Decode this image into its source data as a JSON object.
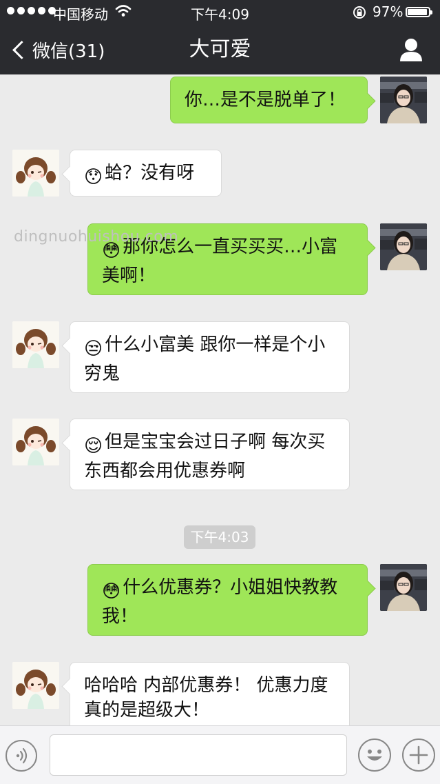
{
  "status_bar": {
    "carrier": "中国移动",
    "time": "下午4:09",
    "battery": "97%",
    "icons": [
      "signal-dots-icon",
      "wifi-icon",
      "rotation-lock-icon",
      "battery-icon"
    ]
  },
  "nav": {
    "back_label": "微信(31)",
    "title": "大可爱",
    "icons": [
      "chevron-left-icon",
      "profile-icon"
    ]
  },
  "watermark": "dingnuohuishou.com",
  "messages": [
    {
      "side": "self",
      "emoji": "",
      "text": "你…是不是脱单了！"
    },
    {
      "side": "other",
      "emoji": "😯",
      "text": "蛤？没有呀"
    },
    {
      "side": "self",
      "emoji": "😳",
      "text": "那你怎么一直买买买…小富美啊！"
    },
    {
      "side": "other",
      "emoji": "😒",
      "text": "什么小富美 跟你一样是个小穷鬼"
    },
    {
      "side": "other",
      "emoji": "😌",
      "text": "但是宝宝会过日子啊 每次买东西都会用优惠券啊"
    },
    {
      "side": "self",
      "emoji": "😳",
      "text": "什么优惠券？小姐姐快教教我！"
    },
    {
      "side": "other",
      "emoji": "",
      "text": "哈哈哈 内部优惠券！ 优惠力度真的是超级大！"
    }
  ],
  "timestamp": "下午4:03",
  "input_bar": {
    "placeholder": "",
    "icons": [
      "voice-icon",
      "emoji-icon",
      "plus-icon"
    ]
  },
  "colors": {
    "nav_background": "#2a2b2f",
    "chat_background": "#ebebeb",
    "self_bubble": "#9fe658",
    "other_bubble": "#ffffff"
  }
}
